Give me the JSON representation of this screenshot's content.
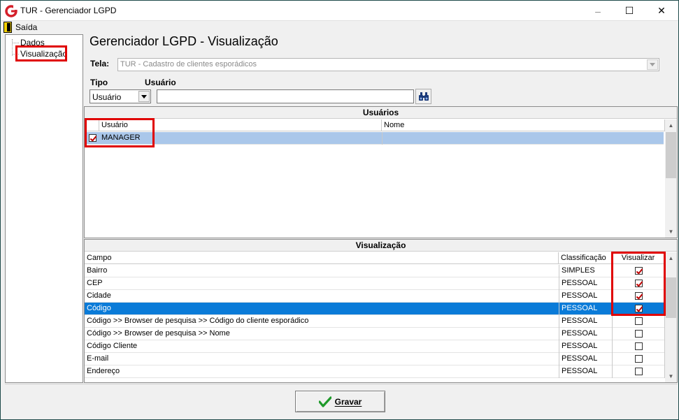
{
  "window": {
    "title": "TUR - Gerenciador LGPD",
    "controls": {
      "minimize": "–",
      "maximize": "☐",
      "close": "✕"
    }
  },
  "menu": {
    "exit_label": "Saída"
  },
  "tree": {
    "items": [
      "Dados",
      "Visualização"
    ]
  },
  "page": {
    "title": "Gerenciador LGPD - Visualização"
  },
  "filters": {
    "tela_label": "Tela:",
    "tela_value": "TUR - Cadastro de clientes esporádicos",
    "tipo_label": "Tipo",
    "tipo_value": "Usuário",
    "usuario_label": "Usuário",
    "usuario_value": ""
  },
  "users_group": {
    "title": "Usuários",
    "columns": [
      "Usuário",
      "Nome"
    ],
    "rows": [
      {
        "usuario": "MANAGER",
        "nome": "",
        "checked": true
      }
    ]
  },
  "view_group": {
    "title": "Visualização",
    "columns": [
      "Campo",
      "Classificação",
      "Visualizar"
    ],
    "rows": [
      {
        "campo": "Bairro",
        "classificacao": "SIMPLES",
        "visualizar": true
      },
      {
        "campo": "CEP",
        "classificacao": "PESSOAL",
        "visualizar": true
      },
      {
        "campo": "Cidade",
        "classificacao": "PESSOAL",
        "visualizar": true
      },
      {
        "campo": "Código",
        "classificacao": "PESSOAL",
        "visualizar": true
      },
      {
        "campo": "Código >> Browser de pesquisa >> Código do cliente esporádico",
        "classificacao": "PESSOAL",
        "visualizar": false
      },
      {
        "campo": "Código >> Browser de pesquisa >> Nome",
        "classificacao": "PESSOAL",
        "visualizar": false
      },
      {
        "campo": "Código Cliente",
        "classificacao": "PESSOAL",
        "visualizar": false
      },
      {
        "campo": "E-mail",
        "classificacao": "PESSOAL",
        "visualizar": false
      },
      {
        "campo": "Endereço",
        "classificacao": "PESSOAL",
        "visualizar": false
      }
    ]
  },
  "footer": {
    "save_label": "Gravar"
  },
  "colors": {
    "accent": "#0a7bd8",
    "highlight": "#e00000",
    "selected_light": "#aac7ea"
  }
}
